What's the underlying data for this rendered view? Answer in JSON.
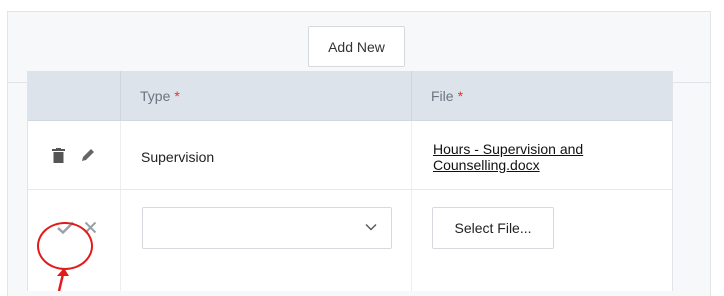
{
  "toolbar": {
    "add_new_label": "Add New"
  },
  "table": {
    "columns": [
      {
        "label": "Type",
        "required_mark": "*"
      },
      {
        "label": "File",
        "required_mark": "*"
      }
    ],
    "rows": [
      {
        "type": "Supervision",
        "file": "Hours - Supervision and Counselling.docx",
        "actions": [
          "trash-icon",
          "pencil-icon"
        ]
      }
    ],
    "edit_row": {
      "type_value": "",
      "file_button_label": "Select File...",
      "actions": [
        "checkmark-icon",
        "close-icon"
      ]
    }
  },
  "annotation": {
    "color": "#e11a1a",
    "shape": "circle-with-arrow"
  }
}
